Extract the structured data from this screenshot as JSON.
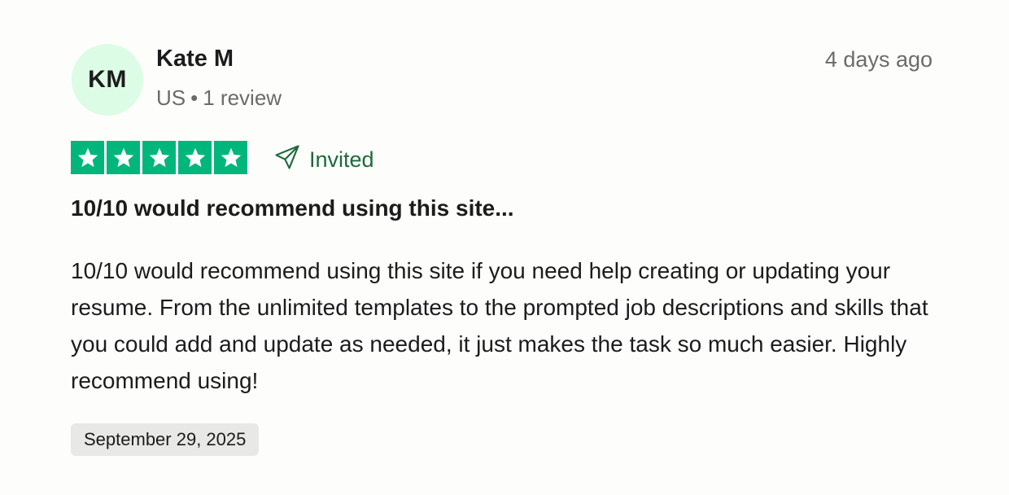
{
  "reviewer": {
    "initials": "KM",
    "name": "Kate M",
    "country": "US",
    "separator": "•",
    "review_count": "1 review"
  },
  "time_ago": "4 days ago",
  "rating": {
    "stars": 5,
    "max": 5,
    "color": "#00b67a"
  },
  "invited": {
    "icon": "paper-plane-icon",
    "label": "Invited",
    "color": "#1d6a3a"
  },
  "review": {
    "title": "10/10 would recommend using this site...",
    "body": "10/10 would recommend using this site if you need help creating or updating your resume. From the unlimited templates to the prompted job descriptions and skills that you could add and update as needed, it just makes the task so much easier. Highly recommend using!"
  },
  "date_of_experience": "September 29, 2025",
  "colors": {
    "avatar_bg": "#dcfce5",
    "badge_bg": "#e8e8e6"
  }
}
